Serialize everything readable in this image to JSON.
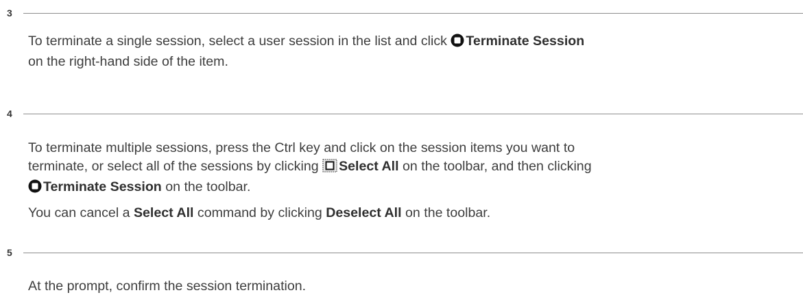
{
  "steps": [
    {
      "number": "3",
      "paragraphs": [
        {
          "before": "To terminate a single session, select a user session in the list and click ",
          "action_label": "Terminate Session",
          "after_line1": "",
          "line2": "on the right-hand side of the item."
        }
      ]
    },
    {
      "number": "4",
      "p1": {
        "l1": "To terminate multiple sessions, press the Ctrl key and click on the session items you want to",
        "l2_before": "terminate, or select all of the sessions by clicking ",
        "select_all_label": "Select All",
        "l2_after": " on the toolbar, and then clicking",
        "terminate_label": "Terminate Session",
        "l3_after": " on the toolbar."
      },
      "p2": {
        "before": "You can cancel a ",
        "select_all_label": "Select All",
        "middle": " command by clicking ",
        "deselect_label": "Deselect All",
        "after": " on the toolbar."
      }
    },
    {
      "number": "5",
      "text": "At the prompt, confirm the session termination."
    }
  ],
  "icons": {
    "terminate": "terminate-session-icon",
    "select_all": "select-all-icon"
  }
}
